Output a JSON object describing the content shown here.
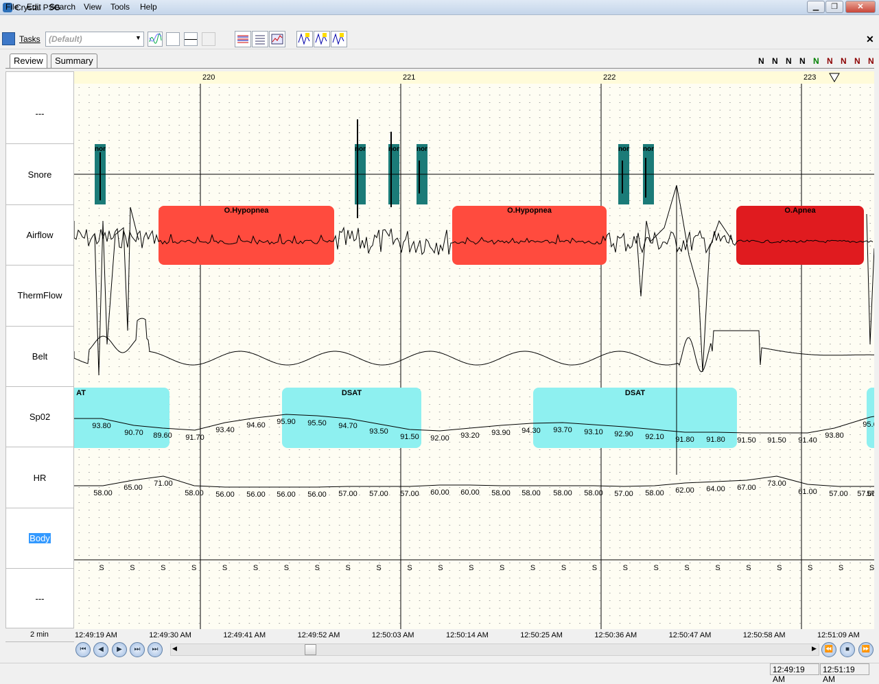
{
  "window": {
    "title": "Crystal PSG"
  },
  "menu": [
    "File",
    "Edit",
    "Search",
    "View",
    "Tools",
    "Help"
  ],
  "toolbar": {
    "tasks_label": "Tasks",
    "preset_value": "(Default)",
    "close_symbol": "✕"
  },
  "tabs": [
    "Review",
    "Summary"
  ],
  "nstatus": [
    {
      "text": "N",
      "color": "#000000"
    },
    {
      "text": "N",
      "color": "#000000"
    },
    {
      "text": "N",
      "color": "#000000"
    },
    {
      "text": "N",
      "color": "#000000"
    },
    {
      "text": "N",
      "color": "#008000"
    },
    {
      "text": "N",
      "color": "#8b0000"
    },
    {
      "text": "N",
      "color": "#8b0000"
    },
    {
      "text": "N",
      "color": "#8b0000"
    },
    {
      "text": "N",
      "color": "#8b0000"
    }
  ],
  "epochs": [
    "220",
    "221",
    "222",
    "223"
  ],
  "channels": [
    "---",
    "Snore",
    "Airflow",
    "ThermFlow",
    "Belt",
    "Sp02",
    "HR",
    "Body",
    "---"
  ],
  "events": {
    "snore_label": "nor",
    "airflow": [
      "O.Hypopnea",
      "O.Hypopnea",
      "O.Apnea"
    ],
    "dsat": [
      "AT",
      "DSAT",
      "DSAT"
    ]
  },
  "spo2_values": [
    "93.80",
    "90.70",
    "89.60",
    "91.70",
    "93.40",
    "94.60",
    "95.90",
    "95.50",
    "94.70",
    "93.50",
    "91.50",
    "92.00",
    "93.20",
    "93.90",
    "94.30",
    "93.70",
    "93.10",
    "92.90",
    "92.10",
    "91.80",
    "91.80",
    "91.50",
    "91.50",
    "91.40",
    "93.80",
    "95.6"
  ],
  "hr_values": [
    "58.00",
    "65.00",
    "71.00",
    "58.00",
    "56.00",
    "56.00",
    "56.00",
    "56.00",
    "57.00",
    "57.00",
    "57.00",
    "60.00",
    "60.00",
    "58.00",
    "58.00",
    "58.00",
    "58.00",
    "57.00",
    "58.00",
    "62.00",
    "64.00",
    "67.00",
    "73.00",
    "61.00",
    "57.00",
    "57.00",
    "57.0"
  ],
  "body_position": "S",
  "time_window": "2 min",
  "times": [
    "12:49:19 AM",
    "12:49:30 AM",
    "12:49:41 AM",
    "12:49:52 AM",
    "12:50:03 AM",
    "12:50:14 AM",
    "12:50:25 AM",
    "12:50:36 AM",
    "12:50:47 AM",
    "12:50:58 AM",
    "12:51:09 AM"
  ],
  "status": {
    "start": "12:49:19 AM",
    "end": "12:51:19 AM"
  },
  "colors": {
    "hypopnea": "#ff4b3e",
    "apnea": "#e01b1f",
    "dsat": "#8ef0f0",
    "snore": "#1b7b78",
    "timescale": "#fffbd9"
  }
}
